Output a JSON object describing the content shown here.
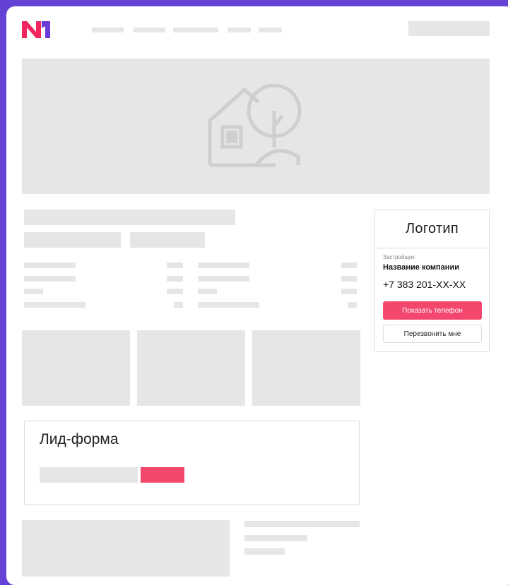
{
  "brand": {
    "logo_text": "N1",
    "accent_color": "#f3476e",
    "frame_color": "#6541d6",
    "logo_colors": [
      "#f0265f",
      "#6a3bd6"
    ]
  },
  "header": {
    "nav_items": [
      "",
      "",
      "",
      "",
      ""
    ],
    "action_placeholder": ""
  },
  "hero": {
    "image_icon": "house-tree-placeholder-icon"
  },
  "builder_card": {
    "logo_label": "Логотип",
    "caption": "Застройщик",
    "company_name": "Название компании",
    "phone": "+7 383 201-XX-XX",
    "show_phone_label": "Показать телефон",
    "callback_label": "Перезвонить мне"
  },
  "lead_form": {
    "title": "Лид-форма",
    "input_value": "",
    "submit_label": ""
  }
}
